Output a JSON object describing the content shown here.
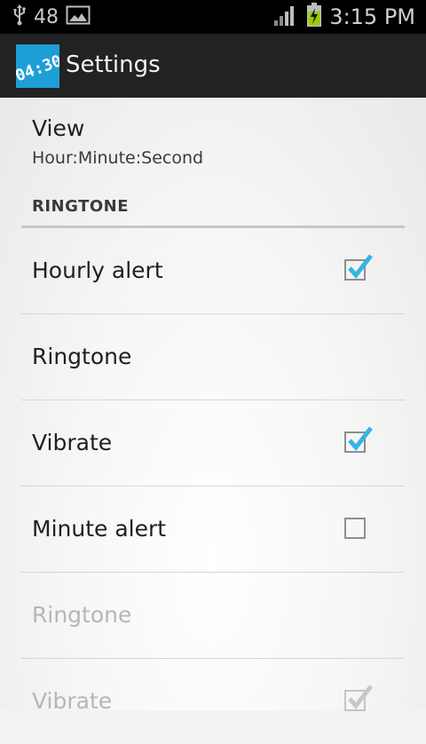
{
  "status_bar": {
    "notification_count": "48",
    "time": "3:15 PM",
    "icons": [
      "usb-icon",
      "image-icon",
      "signal-icon",
      "battery-charging-icon"
    ]
  },
  "action_bar": {
    "app_icon": "clock-app-icon",
    "app_icon_text": "04:30",
    "title": "Settings"
  },
  "view": {
    "title": "View",
    "summary": "Hour:Minute:Second"
  },
  "category": {
    "label": "RINGTONE"
  },
  "items": [
    {
      "label": "Hourly alert",
      "checkbox": true,
      "checked": true,
      "enabled": true
    },
    {
      "label": "Ringtone",
      "checkbox": false,
      "enabled": true
    },
    {
      "label": "Vibrate",
      "checkbox": true,
      "checked": true,
      "enabled": true
    },
    {
      "label": "Minute alert",
      "checkbox": true,
      "checked": false,
      "enabled": true
    },
    {
      "label": "Ringtone",
      "checkbox": false,
      "enabled": false
    },
    {
      "label": "Vibrate",
      "checkbox": true,
      "checked": true,
      "enabled": false
    }
  ],
  "colors": {
    "check_enabled": "#33b5e5",
    "check_disabled": "#c8c8c8",
    "action_bar": "#222222",
    "status_bar": "#000000",
    "app_icon_bg": "#1e9ed6"
  }
}
